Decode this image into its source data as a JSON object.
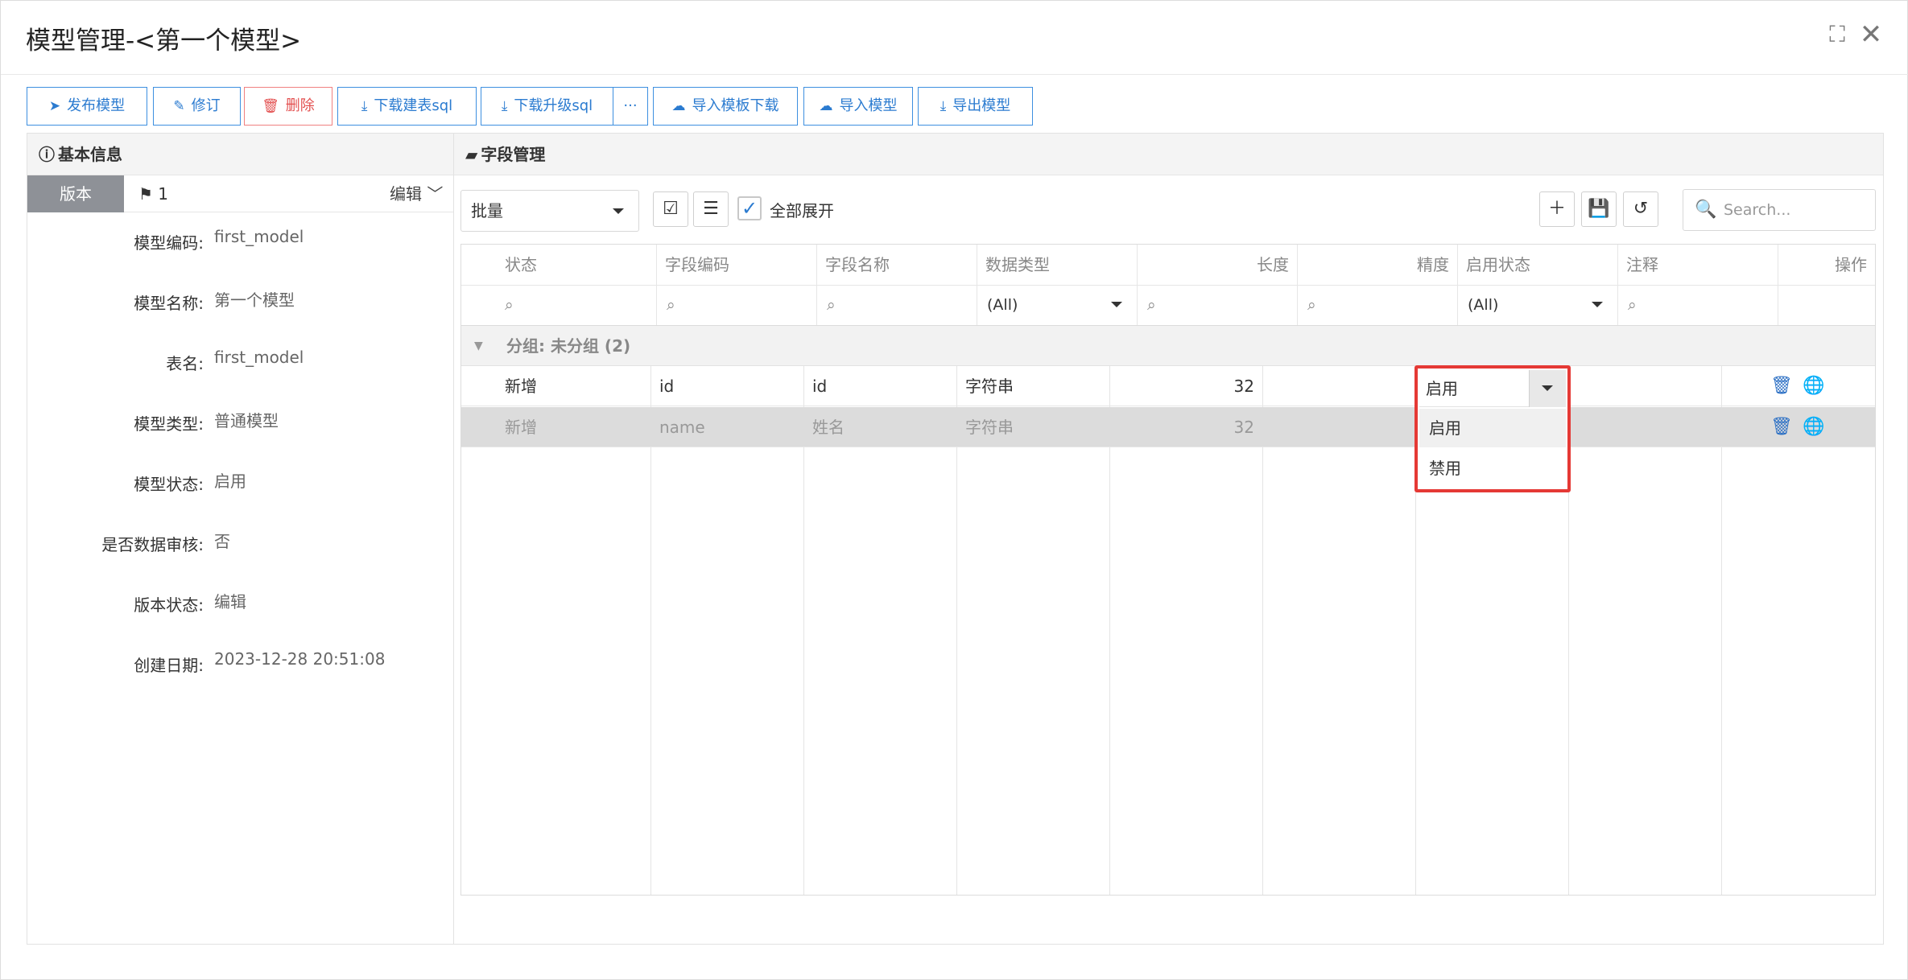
{
  "dialog": {
    "title": "模型管理-<第一个模型>",
    "maximize_icon": "maximize-icon",
    "close_icon": "close-icon"
  },
  "toolbar": [
    {
      "label": "发布模型",
      "icon": "send-icon"
    },
    {
      "label": "修订",
      "icon": "edit-icon"
    },
    {
      "label": "删除",
      "icon": "trash-icon"
    },
    {
      "label": "下载建表sql",
      "icon": "download-icon"
    },
    {
      "label": "下载升级sql",
      "icon": "download-icon"
    },
    {
      "label": "···",
      "icon": "more-icon"
    },
    {
      "label": "导入模板下载",
      "icon": "cloud-upload-icon"
    },
    {
      "label": "导入模型",
      "icon": "cloud-upload-icon"
    },
    {
      "label": "导出模型",
      "icon": "download-icon"
    }
  ],
  "basic_info": {
    "title": "基本信息",
    "version_tab": "版本",
    "version_number": "1",
    "edit_label": "编辑",
    "fields": [
      {
        "label": "模型编码:",
        "value": "first_model"
      },
      {
        "label": "模型名称:",
        "value": "第一个模型"
      },
      {
        "label": "表名:",
        "value": "first_model"
      },
      {
        "label": "模型类型:",
        "value": "普通模型"
      },
      {
        "label": "模型状态:",
        "value": "启用"
      },
      {
        "label": "是否数据审核:",
        "value": "否"
      },
      {
        "label": "版本状态:",
        "value": "编辑"
      },
      {
        "label": "创建日期:",
        "value": "2023-12-28 20:51:08"
      }
    ]
  },
  "field_mgmt": {
    "title": "字段管理",
    "batch_select": "批量",
    "expand_all_label": "全部展开",
    "search_placeholder": "Search...",
    "columns": [
      "状态",
      "字段编码",
      "字段名称",
      "数据类型",
      "长度",
      "精度",
      "启用状态",
      "注释",
      "操作"
    ],
    "filter_all": "(All)",
    "group_label": "分组: 未分组 (2)",
    "rows": [
      {
        "status": "新增",
        "code": "id",
        "name": "id",
        "type": "字符串",
        "length": "32"
      },
      {
        "status": "新增",
        "code": "name",
        "name": "姓名",
        "type": "字符串",
        "length": "32"
      }
    ],
    "dropdown": {
      "value": "启用",
      "options": [
        "启用",
        "禁用"
      ]
    }
  }
}
